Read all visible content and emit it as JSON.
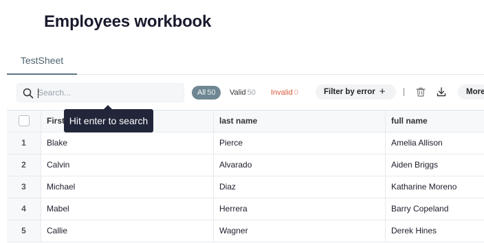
{
  "workbook": {
    "title": "Employees workbook"
  },
  "tabs": [
    {
      "label": "TestSheet"
    }
  ],
  "toolbar": {
    "search_placeholder": "Search...",
    "filter_all_label": "All",
    "filter_all_count": "50",
    "filter_valid_label": "Valid",
    "filter_valid_count": "50",
    "filter_invalid_label": "Invalid",
    "filter_invalid_count": "0",
    "filter_by_error_label": "Filter by error",
    "more_label": "More",
    "icons": [
      "search-icon",
      "plus-icon",
      "trash-icon",
      "download-icon"
    ]
  },
  "tooltip": {
    "text": "Hit enter to search"
  },
  "table": {
    "columns": [
      "First name",
      "last name",
      "full name"
    ],
    "rows": [
      {
        "index": "1",
        "first": "Blake",
        "last": "Pierce",
        "full": "Amelia Allison"
      },
      {
        "index": "2",
        "first": "Calvin",
        "last": "Alvarado",
        "full": "Aiden Briggs"
      },
      {
        "index": "3",
        "first": "Michael",
        "last": "Diaz",
        "full": "Katharine Moreno"
      },
      {
        "index": "4",
        "first": "Mabel",
        "last": "Herrera",
        "full": "Barry Copeland"
      },
      {
        "index": "5",
        "first": "Callie",
        "last": "Wagner",
        "full": "Derek Hines"
      }
    ]
  },
  "colors": {
    "accent": "#6e8792",
    "invalid": "#d9573b",
    "tooltip_bg": "#22263a"
  }
}
